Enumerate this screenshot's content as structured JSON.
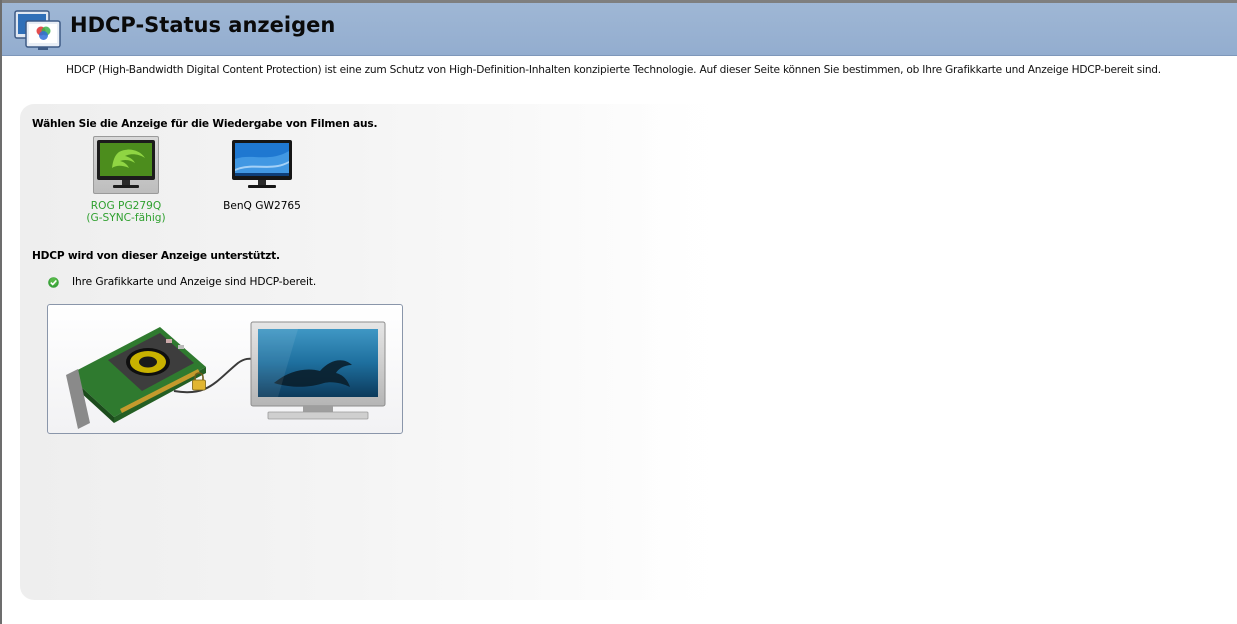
{
  "header": {
    "title": "HDCP-Status anzeigen",
    "icon": "display-properties-icon"
  },
  "intro": "HDCP (High-Bandwidth Digital Content Protection) ist eine zum Schutz von High-Definition-Inhalten konzipierte Technologie. Auf dieser Seite können Sie bestimmen, ob Ihre Grafikkarte und Anzeige HDCP-bereit sind.",
  "select_display": {
    "heading": "Wählen Sie die Anzeige für die Wiedergabe von Filmen aus.",
    "displays": [
      {
        "name": "ROG PG279Q",
        "sub": "(G-SYNC-fähig)",
        "selected": true,
        "icon": "nvidia-monitor-icon"
      },
      {
        "name": "BenQ GW2765",
        "sub": "",
        "selected": false,
        "icon": "windows-monitor-icon"
      }
    ]
  },
  "hdcp": {
    "heading": "HDCP wird von dieser Anzeige unterstützt.",
    "status": "Ihre Grafikkarte und Anzeige sind HDCP-bereit.",
    "status_icon": "green-check-icon"
  },
  "colors": {
    "header_bg": "#9fb7d5",
    "selected_text": "#2fa02f",
    "check_green": "#3aa23a"
  }
}
